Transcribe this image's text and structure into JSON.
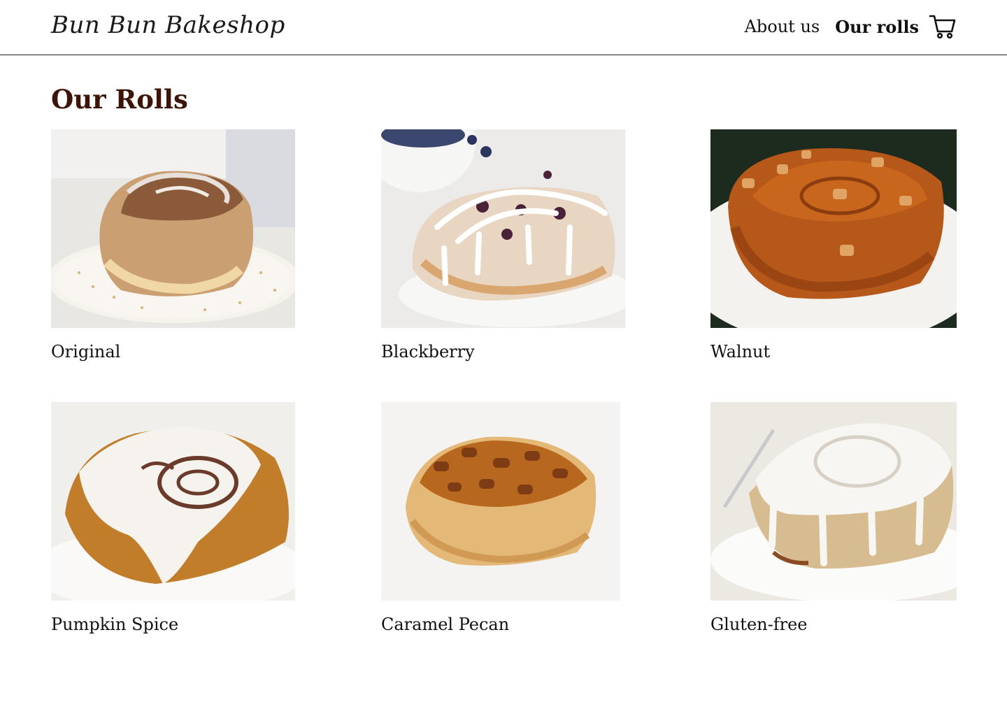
{
  "header": {
    "logo": "Bun Bun Bakeshop",
    "nav": [
      {
        "label": "About us",
        "active": false
      },
      {
        "label": "Our rolls",
        "active": true
      }
    ],
    "cart_icon": "shopping-cart-icon"
  },
  "main": {
    "title": "Our Rolls",
    "rolls": [
      {
        "name": "Original"
      },
      {
        "name": "Blackberry"
      },
      {
        "name": "Walnut"
      },
      {
        "name": "Pumpkin Spice"
      },
      {
        "name": "Caramel Pecan"
      },
      {
        "name": "Gluten-free"
      }
    ]
  },
  "colors": {
    "title": "#3d1408",
    "text": "#111111",
    "divider": "#222222"
  }
}
